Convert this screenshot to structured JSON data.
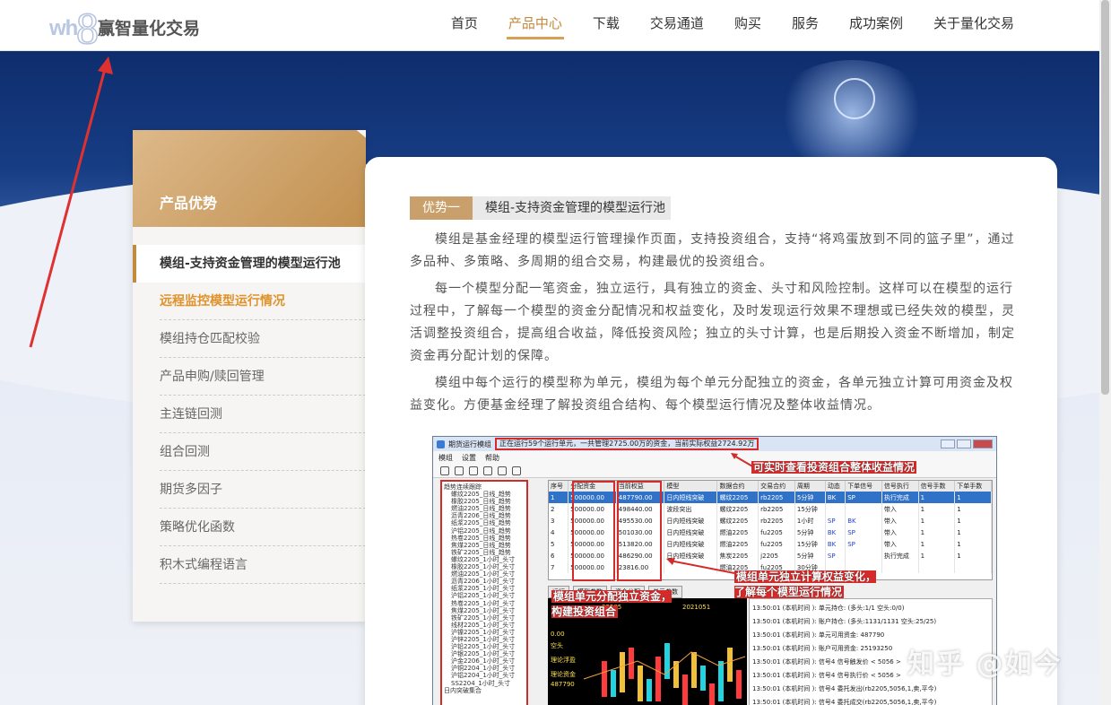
{
  "brand": {
    "logo_mark": "wh",
    "logo_num": "8",
    "name": "赢智量化交易"
  },
  "nav": {
    "items": [
      {
        "label": "首页"
      },
      {
        "label": "产品中心",
        "active": true
      },
      {
        "label": "下载"
      },
      {
        "label": "交易通道"
      },
      {
        "label": "购买"
      },
      {
        "label": "服务"
      },
      {
        "label": "成功案例"
      },
      {
        "label": "关于量化交易"
      }
    ]
  },
  "sidebar": {
    "title": "产品优势",
    "items": [
      {
        "label": "模组-支持资金管理的模型运行池",
        "state": "active"
      },
      {
        "label": "远程监控模型运行情况",
        "state": "hover"
      },
      {
        "label": "模组持仓匹配校验"
      },
      {
        "label": "产品申购/赎回管理"
      },
      {
        "label": "主连链回测"
      },
      {
        "label": "组合回测"
      },
      {
        "label": "期货多因子"
      },
      {
        "label": "策略优化函数"
      },
      {
        "label": "积木式编程语言"
      }
    ]
  },
  "content": {
    "tag_label": "优势一",
    "tag_title": "模组-支持资金管理的模型运行池",
    "paragraphs": [
      "模组是基金经理的模型运行管理操作页面，支持投资组合，支持“将鸡蛋放到不同的篮子里”，通过多品种、多策略、多周期的组合交易，构建最优的投资组合。",
      "每一个模型分配一笔资金，独立运行，具有独立的资金、头寸和风险控制。这样可以在模型的运行过程中，了解每一个模型的资金分配情况和权益变化，及时发现运行效果不理想或已经失效的模型，灵活调整投资组合，提高组合收益，降低投资风险；独立的头寸计算，也是后期投入资金不断增加，制定资金再分配计划的保障。",
      "模组中每个运行的模型称为单元，模组为每个单元分配独立的资金，各单元独立计算可用资金及权益变化。方便基金经理了解投资组合结构、每个模型运行情况及整体收益情况。"
    ]
  },
  "screenshot": {
    "window_title": "期货运行模组",
    "status": "正在运行59个运行单元，一共管理2725.00万的资金，当前实际权益2724.92万",
    "menu": [
      "模组",
      "设置",
      "帮助"
    ],
    "tree_root": "趋势连续跟踪",
    "tree_items": [
      "螺纹2205_日线_趋势",
      "橡胶2205_日线_趋势",
      "燃油2205_日线_趋势",
      "沥青2206_日线_趋势",
      "纸浆2205_日线_趋势",
      "沪铝2205_日线_趋势",
      "热卷2205_日线_趋势",
      "焦煤2205_日线_趋势",
      "铁矿2205_日线_趋势",
      "螺纹2205_1小时_头寸",
      "橡胶2205_1小时_头寸",
      "燃油2205_1小时_头寸",
      "沥青2206_1小时_头寸",
      "纸浆2205_1小时_头寸",
      "沪铝2205_1小时_头寸",
      "热卷2205_1小时_头寸",
      "焦煤2205_1小时_头寸",
      "铁矿2205_1小时_头寸",
      "线材2205_1小时_头寸",
      "沪镍2205_1小时_头寸",
      "沪锌2205_1小时_头寸",
      "沪铅2205_1小时_头寸",
      "沪银2205_1小时_头寸",
      "沪金2206_1小时_头寸",
      "沪铜2204_1小时_头寸",
      "沪铝2204_1小时_头寸",
      "SS2204_1小时_头寸"
    ],
    "tree_footer": "日内突破集合",
    "table": {
      "headers": [
        "序号",
        "分配资金",
        "当前权益",
        "模型",
        "数据合约",
        "交易合约",
        "周期",
        "动态",
        "下单信号",
        "信号执行",
        "信号手数",
        "下单手数"
      ],
      "rows": [
        [
          "1",
          "500000.00",
          "487790.00",
          "日内短线突破",
          "螺纹2205",
          "rb2205",
          "5分钟",
          "BK",
          "SP",
          "执行完成",
          "1",
          "1"
        ],
        [
          "2",
          "500000.00",
          "498440.00",
          "波段突出",
          "螺纹2205",
          "rb2205",
          "15分钟",
          "",
          "",
          "带入",
          "1",
          "1"
        ],
        [
          "3",
          "500000.00",
          "495530.00",
          "日内短线突破",
          "螺纹2205",
          "rb2205",
          "1小时",
          "SP",
          "BK",
          "带入",
          "1",
          "1"
        ],
        [
          "4",
          "500000.00",
          "501030.00",
          "日内短线突破",
          "燃油2205",
          "fu2205",
          "5分钟",
          "BK",
          "SP",
          "带入",
          "1",
          "1"
        ],
        [
          "5",
          "500000.00",
          "513820.00",
          "日内短线突破",
          "燃油2205",
          "fu2205",
          "15分钟",
          "BK",
          "SP",
          "带入",
          "1",
          "1"
        ],
        [
          "6",
          "500000.00",
          "486290.00",
          "日内短线突破",
          "焦炭2205",
          "j2205",
          "5分钟",
          "SP",
          "",
          "执行完成",
          "1",
          "1"
        ],
        [
          "7",
          "500000.00",
          "23816.00",
          "",
          "燃油2205",
          "fu2205",
          "30分钟",
          "",
          "",
          "",
          "",
          ""
        ]
      ]
    },
    "tabs": [
      "运行",
      "模型参数",
      "资金分配",
      "单元参数"
    ],
    "chart_tag1": "S2205",
    "chart_tag2": "2021051",
    "chart_label_1": "空头",
    "chart_label_2": "理论浮盈",
    "chart_label_3": "理论资金",
    "chart_value_1": "0.00",
    "chart_value_2": "487790",
    "log_lines": [
      "13:50:01 (本机时间    ): 单元持仓: (多头:1/1 空头:0/0)",
      "13:50:01 (本机时间    ): 账户持仓: (多头:1131/1131 空头:25/25)",
      "13:50:01 (本机时间    ): 单元可用资金: 487790",
      "13:50:01 (本机时间    ): 账户可用资金: 25193250",
      "13:50:01 (本机时间    ): 信号4 信号触发价 < 5056 >",
      "13:50:01 (本机时间    ): 信号4 信号执行价 < 5056 >",
      "13:50:01 (本机时间    ): 信号4 委托发出(rb2205,5056,1,卖,平今)",
      "13:50:01 (本机时间    ): 信号4 委托成交(rb2205,5056,1,卖,平今)"
    ],
    "annot_top": "可实时查看投资组合整体收益情况",
    "annot_mid": "模组单元独立计算权益变化，了解每个模型运行情况",
    "annot_left": "模组单元分配独立资金，构建投资组合"
  },
  "watermark": "知乎 @如今",
  "colors": {
    "accent_gold": "#c28a3c",
    "hover_orange": "#e0922b",
    "annotation_red": "#d42a2a",
    "hero_navy": "#0e2d6d"
  }
}
